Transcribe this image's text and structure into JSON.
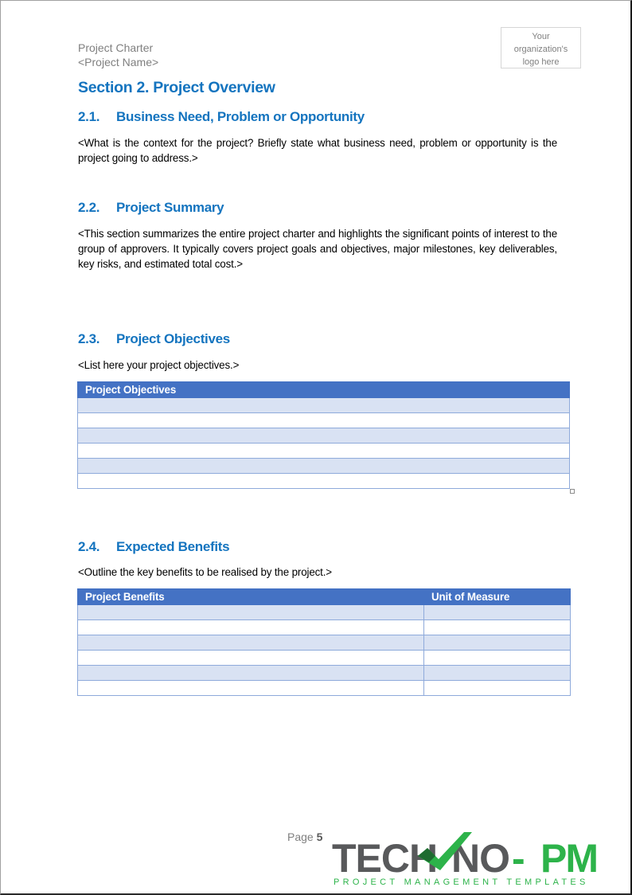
{
  "header": {
    "doc_title": "Project Charter",
    "project_name": "<Project Name>",
    "logo_placeholder": [
      "Your",
      "organization's",
      "logo here"
    ]
  },
  "section": {
    "title": "Section 2. Project Overview"
  },
  "subsections": [
    {
      "number": "2.1.",
      "title": "Business Need, Problem or Opportunity",
      "text": "<What is the context for the project? Briefly state what business need, problem or opportunity is the project going to address.>"
    },
    {
      "number": "2.2.",
      "title": "Project Summary",
      "text": "<This section summarizes the entire project charter and highlights the significant points of interest to the group of approvers. It typically covers project goals and objectives, major milestones, key deliverables, key risks, and estimated total cost.>"
    },
    {
      "number": "2.3.",
      "title": "Project Objectives",
      "text": "<List here your project objectives.>"
    },
    {
      "number": "2.4.",
      "title": "Expected Benefits",
      "text": "<Outline the key benefits to be realised by the project.>"
    }
  ],
  "objectives_table": {
    "columns": [
      "Project Objectives"
    ],
    "rows": [
      [
        ""
      ],
      [
        ""
      ],
      [
        ""
      ],
      [
        ""
      ],
      [
        ""
      ],
      [
        ""
      ]
    ]
  },
  "benefits_table": {
    "columns": [
      "Project Benefits",
      "Unit of Measure"
    ],
    "rows": [
      [
        "",
        ""
      ],
      [
        "",
        ""
      ],
      [
        "",
        ""
      ],
      [
        "",
        ""
      ],
      [
        "",
        ""
      ],
      [
        "",
        ""
      ]
    ]
  },
  "footer": {
    "page_label": "Page",
    "page_number": "5",
    "brand": {
      "name_left": "TECH",
      "name_mid": "NO",
      "dash": "-",
      "name_right": "PM",
      "tagline": "PROJECT MANAGEMENT TEMPLATES",
      "grey": "#58595b",
      "green": "#2db34a",
      "dark_green": "#1e6b30"
    }
  },
  "colors": {
    "heading_blue": "#1474bf",
    "table_header": "#4472c4",
    "table_band": "#d9e2f3",
    "table_border": "#8eaadb"
  }
}
